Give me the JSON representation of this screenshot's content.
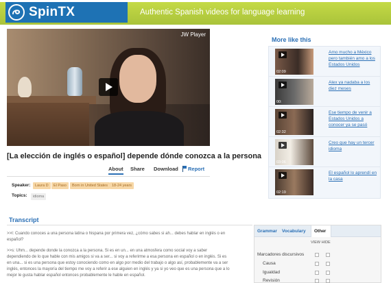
{
  "header": {
    "logo_text": "SpinTX",
    "tagline": "Authentic Spanish videos for language learning"
  },
  "video": {
    "player_label": "JW Player",
    "title": "[La elección de inglés o español] depende dónde conozca a la persona"
  },
  "tabs": {
    "about": "About",
    "share": "Share",
    "download": "Download",
    "report": "Report"
  },
  "meta": {
    "speaker_label": "Speaker:",
    "speaker_tags": [
      "Laura D",
      "El Paso",
      "Born in United States",
      "18-24 years"
    ],
    "topics_label": "Topics:",
    "topic_tags": [
      "idioma"
    ]
  },
  "more_like_this": {
    "title": "More like this",
    "items": [
      {
        "title": "Amo mucho a México pero también amo a los Estados Unidos",
        "duration": "02:09"
      },
      {
        "title": "Alex ya nadaba a los diez meses",
        "duration": "00:"
      },
      {
        "title": "Ese tiempo de venir a Estados Unidos a conocer ya se pasó",
        "duration": "02:32"
      },
      {
        "title": "Creo que hay un tercer idioma",
        "duration": "03:06"
      },
      {
        "title": "El español lo aprendí en la casa",
        "duration": "02:19"
      }
    ]
  },
  "transcript": {
    "title": "Transcript",
    "lines": [
      ">>I: Cuando conoces a una persona latina o hispana por primera vez, ¿cómo sabes si ah... debes hablar en inglés o en",
      "español?",
      ">>s: Uhm... depende donde la conozca a la persona. Si es en un... en una atmosfera como social voy a saber",
      "dependiendo de lo que hable con mis amigos si va a ser... si voy a referirme a esa persona en español o en inglés. Si es",
      "en una... si es una persona que estoy conociendo como en algo por medio del trabajo o algo así, probablemente va a ser",
      "inglés, entonces la mayoría del tiempo me voy a referir a ese alguien en inglés y ya si yo veo que es una persona que a lo",
      "mejor le gusta hablar español entonces probablemente le hable en español."
    ]
  },
  "panel": {
    "tabs": [
      "Grammar",
      "Vocabulary",
      "Other"
    ],
    "active_tab": "Other",
    "view_hide": "VIEW HIDE",
    "marker_heading": "Marcadores discursivos",
    "markers": [
      "Causa",
      "Igualdad",
      "Revisión"
    ]
  }
}
